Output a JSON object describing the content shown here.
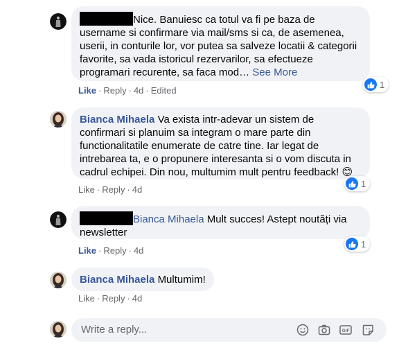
{
  "comments": [
    {
      "author": "",
      "text": "Nice. Banuiesc ca totul va fi pe baza de username si confirmare via mail/sms si ca, de asemenea, userii, in conturile lor, vor putea sa salveze locatii & categorii favorite, sa vada istoricul rezervarilor, sa efectueze programari recurente, sa faca mod…",
      "see_more": "See More",
      "like": "Like",
      "reply": "Reply",
      "time": "4d",
      "edited": "Edited",
      "reaction_count": "1"
    },
    {
      "author": "Bianca Mihaela",
      "text": "Va exista intr-adevar un sistem de confirmari si planuim sa integram o mare parte din functionalitatile enumerate de catre tine. Iar legat de intrebarea ta, e o propunere interesanta si o vom discuta in cadrul echipei. Din nou, multumim mult pentru feedback!",
      "emoji": "😊",
      "like": "Like",
      "reply": "Reply",
      "time": "4d",
      "reaction_count": "1"
    },
    {
      "author": "",
      "mention": "Bianca Mihaela",
      "text": "Mult succes! Astept noutăți via newsletter",
      "like": "Like",
      "reply": "Reply",
      "time": "4d",
      "reaction_count": "1"
    },
    {
      "author": "Bianca Mihaela",
      "text": "Multumim!",
      "like": "Like",
      "reply": "Reply",
      "time": "4d"
    }
  ],
  "reply_box": {
    "placeholder": "Write a reply...",
    "icons": [
      "emoji-icon",
      "camera-icon",
      "gif-icon",
      "sticker-icon"
    ]
  },
  "colors": {
    "link": "#385898",
    "bubble": "#f0f2f5",
    "meta": "#65676b",
    "like_blue": "#1877f2"
  }
}
